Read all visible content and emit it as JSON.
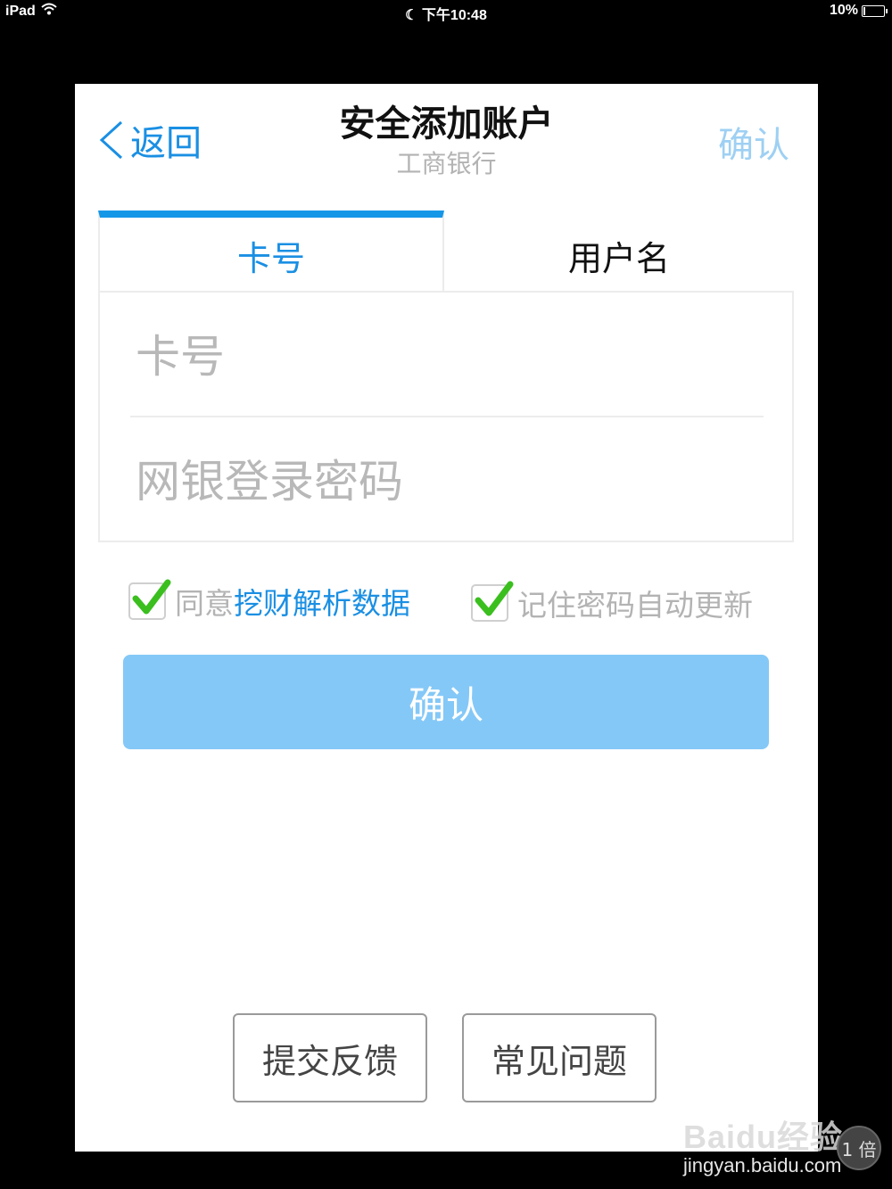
{
  "status_bar": {
    "device": "iPad",
    "time": "下午10:48",
    "battery": "10%",
    "battery_level": 0.1
  },
  "header": {
    "back_label": "返回",
    "title": "安全添加账户",
    "subtitle": "工商银行",
    "confirm_label": "确认"
  },
  "tabs": [
    {
      "label": "卡号",
      "active": true
    },
    {
      "label": "用户名",
      "active": false
    }
  ],
  "form": {
    "card_placeholder": "卡号",
    "card_value": "",
    "password_placeholder": "网银登录密码",
    "password_value": ""
  },
  "options": {
    "agree_prefix": "同意",
    "agree_link": "挖财解析数据",
    "agree_checked": true,
    "remember_label": "记住密码自动更新",
    "remember_checked": true
  },
  "submit_label": "确认",
  "footer": {
    "feedback_label": "提交反馈",
    "faq_label": "常见问题"
  },
  "watermark": {
    "logo": "Baidu经验",
    "url": "jingyan.baidu.com"
  },
  "zoom_badge": "1 倍",
  "colors": {
    "accent": "#1a8fe3",
    "button": "#84c8f7",
    "check": "#3bbf1f"
  }
}
